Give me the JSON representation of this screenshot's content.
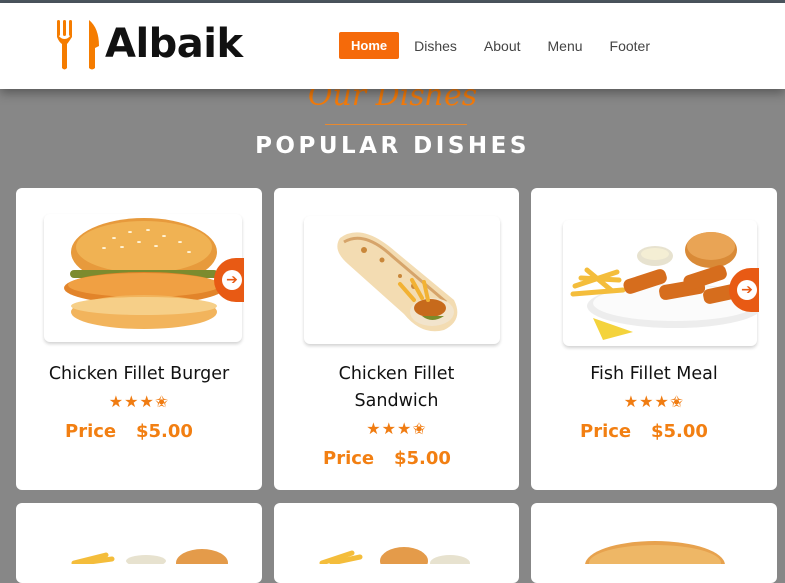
{
  "brand": {
    "name": "Albaik",
    "accent": "#f57c00"
  },
  "nav": {
    "items": [
      {
        "label": "Home",
        "active": true
      },
      {
        "label": "Dishes",
        "active": false
      },
      {
        "label": "About",
        "active": false
      },
      {
        "label": "Menu",
        "active": false
      },
      {
        "label": "Footer",
        "active": false
      }
    ]
  },
  "section": {
    "subtitle": "Our Dishes",
    "title": "POPULAR DISHES"
  },
  "dishes": [
    {
      "name": "Chicken Fillet Burger",
      "rating": 3.5,
      "price_label": "Price",
      "price": "$5.00",
      "image_icon": "burger-image"
    },
    {
      "name": "Chicken Fillet Sandwich",
      "rating": 3.5,
      "price_label": "Price",
      "price": "$5.00",
      "image_icon": "wrap-image"
    },
    {
      "name": "Fish Fillet Meal",
      "rating": 3.5,
      "price_label": "Price",
      "price": "$5.00",
      "image_icon": "fish-meal-image"
    }
  ],
  "stars_text": "★★★✬",
  "arrow_icon": "arrow-right-icon"
}
